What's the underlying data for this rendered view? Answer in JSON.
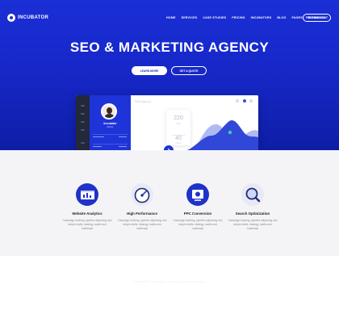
{
  "brand": {
    "name": "INCUBATOR"
  },
  "nav": {
    "items": [
      "HOME",
      "SERVICES",
      "CASE STUDIES",
      "PRICING",
      "INCUBATORS",
      "BLOG",
      "PAGES",
      "ELEMENTS"
    ],
    "cta": "FREE DISCOUNT"
  },
  "hero": {
    "title": "SEO & MARKETING AGENCY",
    "primary_button": "LEARN MORE",
    "secondary_button": "GET A QUOTE"
  },
  "mockup": {
    "profile_name": "Incubator",
    "profile_role": "Partner",
    "main_title": "Web Agency",
    "stat_top": "220",
    "stat_top_label": "visits",
    "stat_bottom": "40",
    "stat_bottom_label": "orders"
  },
  "features": [
    {
      "title": "Website Analytics",
      "desc": "Campaign-tracking, pipeline adipiscing and simple drafts, strategy, audits and roadmaps"
    },
    {
      "title": "High Performance",
      "desc": "Campaign-tracking, pipeline adipiscing and simple drafts, strategy, audits and roadmaps"
    },
    {
      "title": "PPC Conversion",
      "desc": "Campaign-tracking, pipeline adipiscing and simple drafts, strategy, audits and roadmaps"
    },
    {
      "title": "Search Optimization",
      "desc": "Campaign-tracking, pipeline adipiscing and simple drafts, strategy, audits and roadmaps"
    }
  ],
  "footer": {
    "text": "Copyright © Incubator Theme by Qode Interactive"
  },
  "colors": {
    "hero_blue": "#1a2fd6",
    "accent": "#1d2fcf",
    "chart_blue": "#3047d8",
    "icon_bg": "#e7e9f6"
  },
  "icons": [
    "analytics-icon",
    "speedometer-icon",
    "ppc-icon",
    "magnifier-icon"
  ]
}
